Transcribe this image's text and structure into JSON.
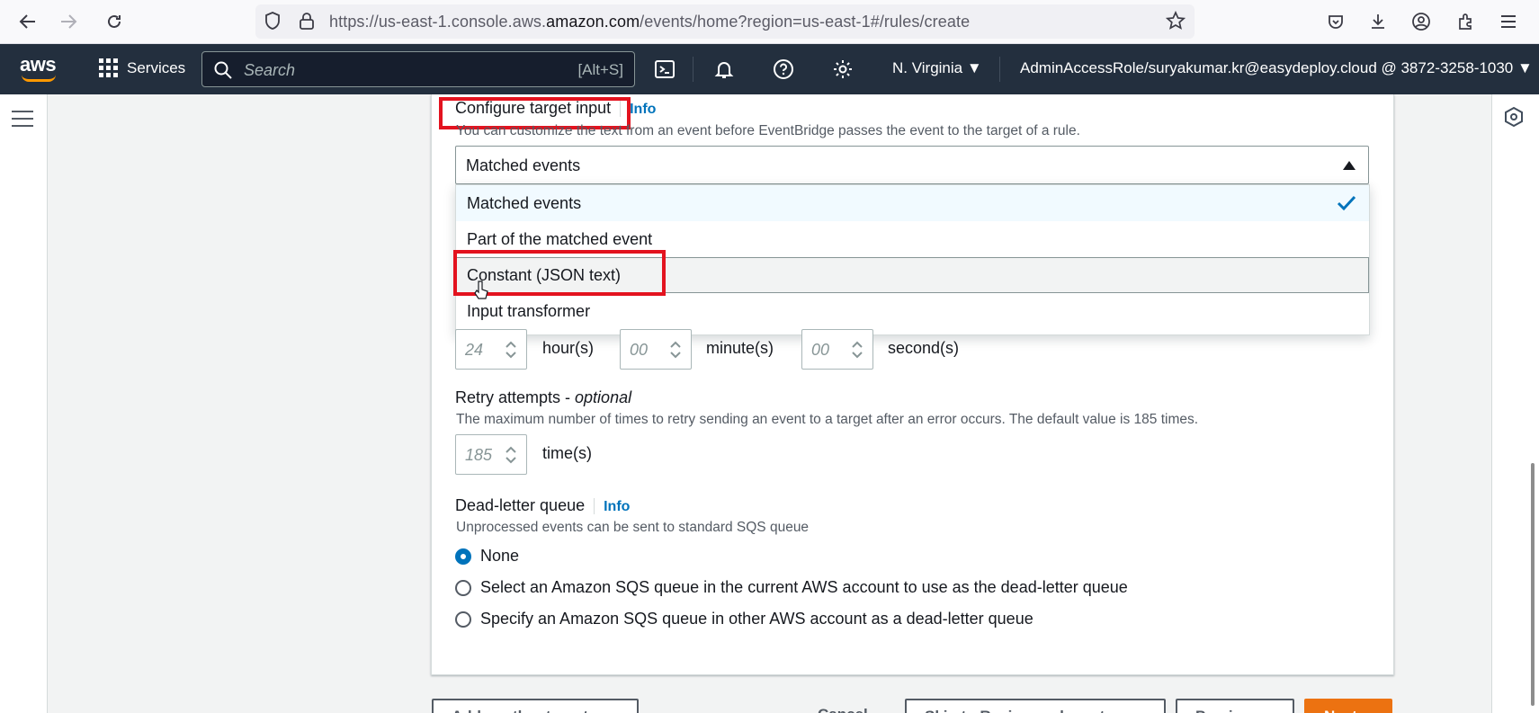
{
  "browser": {
    "url_prefix": "https://us-east-1.console.aws.",
    "url_domain": "amazon.com",
    "url_suffix": "/events/home?region=us-east-1#/rules/create"
  },
  "aws_nav": {
    "logo": "aws",
    "services_label": "Services",
    "search_placeholder": "Search",
    "search_shortcut": "[Alt+S]",
    "region": "N. Virginia",
    "account": "AdminAccessRole/suryakumar.kr@easydeploy.cloud @ 3872-3258-1030"
  },
  "target_input": {
    "title": "Configure target input",
    "info": "Info",
    "description": "You can customize the text from an event before EventBridge passes the event to the target of a rule.",
    "selected_value": "Matched events",
    "options": [
      "Matched events",
      "Part of the matched event",
      "Constant (JSON text)",
      "Input transformer"
    ]
  },
  "max_age": {
    "hours_value": "24",
    "hours_unit": "hour(s)",
    "minutes_value": "00",
    "minutes_unit": "minute(s)",
    "seconds_value": "00",
    "seconds_unit": "second(s)"
  },
  "retry": {
    "label": "Retry attempts - ",
    "label_optional": "optional",
    "description": "The maximum number of times to retry sending an event to a target after an error occurs. The default value is 185 times.",
    "value": "185",
    "unit": "time(s)"
  },
  "dlq": {
    "label": "Dead-letter queue",
    "info": "Info",
    "description": "Unprocessed events can be sent to standard SQS queue",
    "options": [
      "None",
      "Select an Amazon SQS queue in the current AWS account to use as the dead-letter queue",
      "Specify an Amazon SQS queue in other AWS account as a dead-letter queue"
    ],
    "selected_index": 0
  },
  "footer": {
    "add_target": "Add another target",
    "cancel": "Cancel",
    "skip": "Skip to Review and create",
    "previous": "Previous",
    "next": "Next"
  },
  "colors": {
    "nav_bg": "#232f3e",
    "accent_orange": "#ec7211",
    "link_blue": "#0073bb",
    "highlight_red": "#e3131f"
  }
}
